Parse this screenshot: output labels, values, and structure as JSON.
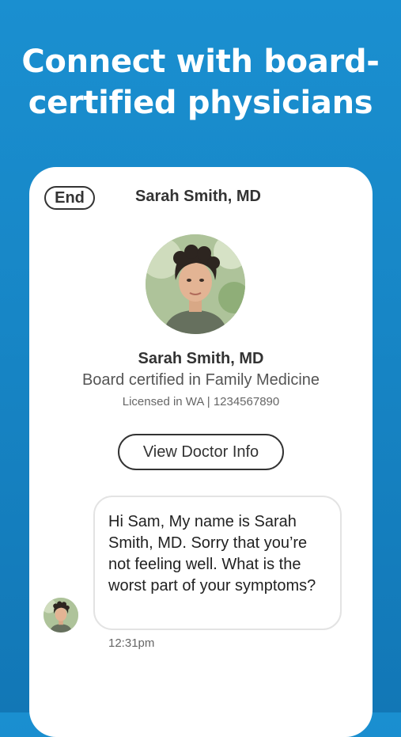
{
  "headline": {
    "line1": "Connect with board-",
    "line2": "certified physicians"
  },
  "call_header": {
    "end_label": "End",
    "title": "Sarah Smith, MD"
  },
  "doctor": {
    "name": "Sarah Smith, MD",
    "certification": "Board certified in Family Medicine",
    "license": "Licensed in WA | 1234567890",
    "view_info_label": "View Doctor Info"
  },
  "chat": {
    "message": "Hi Sam, My name is Sarah Smith, MD. Sorry that you’re not feeling well. What is the worst part of your symptoms?",
    "time": "12:31pm"
  }
}
